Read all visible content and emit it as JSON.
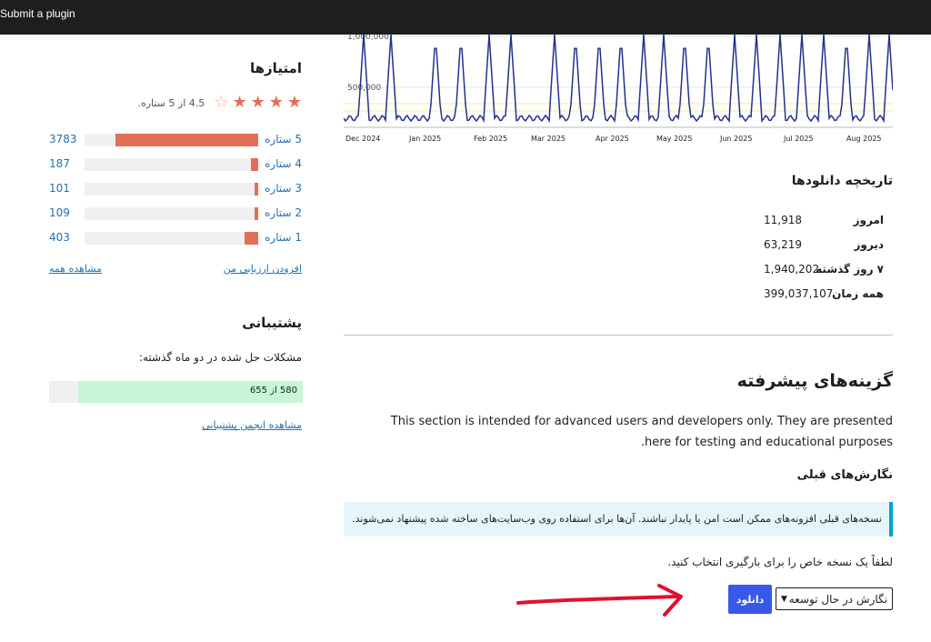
{
  "topbar": {
    "submit_link": "Submit a plugin"
  },
  "ratings": {
    "title": "امتیازها",
    "average_text": "4.5 از 5 ستاره.",
    "average": 4.5,
    "max": 5,
    "rows": [
      {
        "label": "5 ستاره",
        "count": "3783",
        "fraction": 0.82
      },
      {
        "label": "4 ستاره",
        "count": "187",
        "fraction": 0.04
      },
      {
        "label": "3 ستاره",
        "count": "101",
        "fraction": 0.02
      },
      {
        "label": "2 ستاره",
        "count": "109",
        "fraction": 0.02
      },
      {
        "label": "1 ستاره",
        "count": "403",
        "fraction": 0.08
      }
    ],
    "add_review": "افزودن ارزیابی من",
    "see_all": "مشاهده همه"
  },
  "support": {
    "title": "پشتیبانی",
    "subtitle": "مشکلات حل شده در دو ماه گذشته:",
    "resolved_text": "580 از 655",
    "resolved_fraction": 0.886,
    "forum_link": "مشاهده انجمن پشتیبانی"
  },
  "chart_data": {
    "type": "line",
    "y_tick_labels": [
      "1,000,000",
      "500,000"
    ],
    "x_tick_labels": [
      "Dec 2024",
      "Jan 2025",
      "Feb 2025",
      "Mar 2025",
      "Apr 2025",
      "May 2025",
      "Jun 2025",
      "Jul 2025",
      "Aug 2025"
    ],
    "ylim": [
      0,
      1000000
    ],
    "grid": true,
    "series_color": "#23318c"
  },
  "downloads": {
    "title": "تاریخچه دانلودها",
    "rows": [
      {
        "label": "امروز",
        "value": "11,918"
      },
      {
        "label": "دیروز",
        "value": "63,219"
      },
      {
        "label": "۷ روز گذشته",
        "value": "1,940,202"
      },
      {
        "label": "همه زمان",
        "value": "399,037,107"
      }
    ]
  },
  "advanced": {
    "title": "گزینه‌های پیشرفته",
    "text": "This section is intended for advanced users and developers only. They are presented here for testing and educational purposes.",
    "previous_title": "نگارش‌های قبلی",
    "notice": "نسخه‌های قبلی افزونه‌های ممکن است امن یا پایدار نباشند. آن‌ها برای استفاده روی وب‌سایت‌های ساخته شده پیشنهاد نمی‌شوند.",
    "choose_text": "لطفاً یک نسخه خاص را برای بارگیری انتخاب کنید.",
    "download_button": "دانلود",
    "selected_version": "نگارش در حال توسعه"
  },
  "colors": {
    "accent": "#3858e9",
    "star": "#e26f56",
    "link": "#2271b1",
    "arrow": "#e0102f"
  }
}
